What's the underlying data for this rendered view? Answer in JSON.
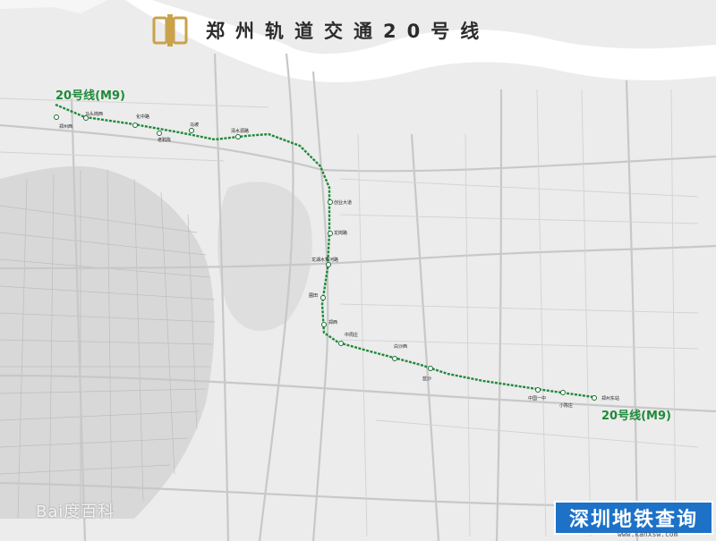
{
  "title": "郑州轨道交通20号线",
  "line_label_top": "20号线(M9)",
  "line_label_bottom": "20号线(M9)",
  "colors": {
    "line": "#1f8a3a",
    "river": "#ffffff",
    "background": "#ececec",
    "logo": "#c9a24a",
    "watermark_box": "#1d72c8"
  },
  "stations": [
    "郑州西",
    "马头岗西",
    "化中路",
    "老鸦陈",
    "马坡",
    "清水源路",
    "创业大道",
    "龙岗路",
    "龙湖水秀河路",
    "圃田",
    "郑西",
    "中周庄",
    "白沙西",
    "蓝沙",
    "中国一中",
    "小陈庄",
    "郑州东站"
  ],
  "watermarks": {
    "baidu": "Bai度百科",
    "site_name": "深圳地铁查询",
    "site_url": "www.kanxsw.com"
  }
}
